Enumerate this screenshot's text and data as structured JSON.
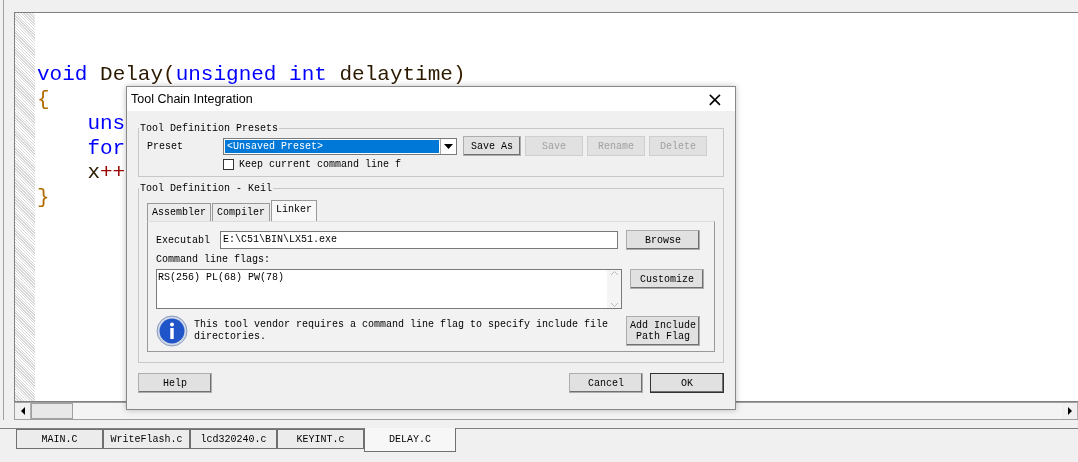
{
  "editor": {
    "lines": [
      [
        {
          "text": "void",
          "kind": "keyword"
        },
        {
          "text": " Delay",
          "kind": "ident"
        },
        {
          "text": "(",
          "kind": "punct"
        },
        {
          "text": "unsigned",
          "kind": "keyword"
        },
        {
          "text": " int",
          "kind": "keyword"
        },
        {
          "text": " delaytime",
          "kind": "ident"
        },
        {
          "text": ")",
          "kind": "punct"
        }
      ],
      [
        {
          "text": "{",
          "kind": "brace"
        }
      ],
      [
        {
          "text": "    uns",
          "kind": "keyword"
        }
      ],
      [
        {
          "text": "    for",
          "kind": "keyword"
        }
      ],
      [
        {
          "text": "    x",
          "kind": "ident"
        },
        {
          "text": "++",
          "kind": "operator"
        }
      ],
      [
        {
          "text": "}",
          "kind": "brace"
        }
      ]
    ]
  },
  "dialog": {
    "title": "Tool Chain Integration",
    "close": "×",
    "presets": {
      "legend": "Tool Definition Presets",
      "label": "Preset",
      "value": "<Unsaved Preset>",
      "buttons": [
        {
          "label": "Save As",
          "disabled": false
        },
        {
          "label": "Save",
          "disabled": true
        },
        {
          "label": "Rename",
          "disabled": true
        },
        {
          "label": "Delete",
          "disabled": true
        }
      ],
      "checkbox": {
        "label": "Keep current command line f",
        "checked": false
      }
    },
    "definition": {
      "legend": "Tool Definition - Keil",
      "tabs": [
        {
          "label": "Assembler",
          "selected": false
        },
        {
          "label": "Compiler",
          "selected": false
        },
        {
          "label": "Linker",
          "selected": true
        }
      ],
      "executable": {
        "label": "Executabl",
        "value": "E:\\C51\\BIN\\LX51.exe",
        "button": "Browse"
      },
      "flags": {
        "label": "Command line flags:",
        "value": "RS(256) PL(68) PW(78)",
        "button": "Customize"
      },
      "info": {
        "text": "This tool vendor requires a command line flag to specify include file directories.",
        "button": [
          "Add Include",
          "Path Flag"
        ]
      }
    },
    "buttons": {
      "help": "Help",
      "cancel": "Cancel",
      "ok": "OK"
    }
  },
  "file_tabs": [
    {
      "label": "MAIN.C",
      "selected": false
    },
    {
      "label": "WriteFlash.c",
      "selected": false
    },
    {
      "label": "lcd320240.c",
      "selected": false
    },
    {
      "label": "KEYINT.c",
      "selected": false
    },
    {
      "label": "DELAY.C",
      "selected": true
    }
  ]
}
